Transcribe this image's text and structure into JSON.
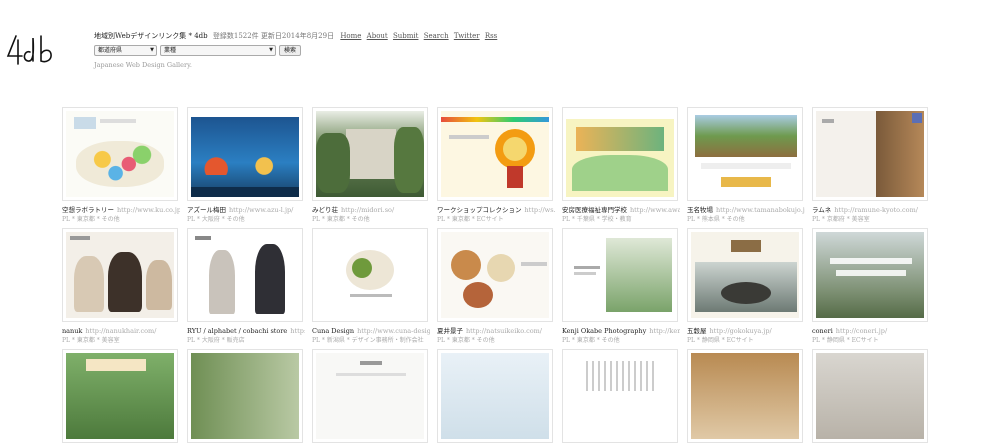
{
  "logo_text": "4db",
  "header": {
    "site_title": "地域別Webデザインリンク集 * 4db",
    "meta": "登録数1522件 更新日2014年8月29日",
    "nav": [
      "Home",
      "About",
      "Submit",
      "Search",
      "Twitter",
      "Rss"
    ],
    "prefecture_select": "都道府県",
    "industry_select": "業種",
    "search_button": "検索",
    "tagline": "Japanese Web Design Gallery."
  },
  "sites": [
    {
      "name": "空想ラボラトリー",
      "url": "http://www.ku.co.jp/",
      "meta": "PL * 東京都 * その他"
    },
    {
      "name": "アズール梅田",
      "url": "http://www.azu-l.jp/",
      "meta": "PL * 大阪府 * その他"
    },
    {
      "name": "みどり荘",
      "url": "http://midori.so/",
      "meta": "PL * 東京都 * その他"
    },
    {
      "name": "ワークショップコレクション",
      "url": "http://ws...",
      "meta": "PL * 東京都 * ECサイト"
    },
    {
      "name": "安房医療福祉専門学校",
      "url": "http://www.awa-...",
      "meta": "PL * 千葉県 * 学校・教育"
    },
    {
      "name": "玉名牧場",
      "url": "http://www.tamanabokujo.jp/",
      "meta": "PL * 熊本県 * その他"
    },
    {
      "name": "ラムネ",
      "url": "http://ramune-kyoto.com/",
      "meta": "PL * 京都府 * 美容室"
    },
    {
      "name": "nanuk",
      "url": "http://nanukhair.com/",
      "meta": "PL * 東京都 * 美容室"
    },
    {
      "name": "RYU / alphabet / cobachi store",
      "url": "http://co...",
      "meta": "PL * 大阪府 * 販売店"
    },
    {
      "name": "Cuna Design",
      "url": "http://www.cuna-design.co...",
      "meta": "PL * 新潟県 * デザイン事務所・制作会社"
    },
    {
      "name": "夏井景子",
      "url": "http://natsuikeiko.com/",
      "meta": "PL * 東京都 * その他"
    },
    {
      "name": "Kenji Okabe Photography",
      "url": "http://kenjioka...",
      "meta": "PL * 東京都 * その他"
    },
    {
      "name": "五穀屋",
      "url": "http://gokokuya.jp/",
      "meta": "PL * 静岡県 * ECサイト"
    },
    {
      "name": "coneri",
      "url": "http://coneri.jp/",
      "meta": "PL * 静岡県 * ECサイト"
    }
  ]
}
